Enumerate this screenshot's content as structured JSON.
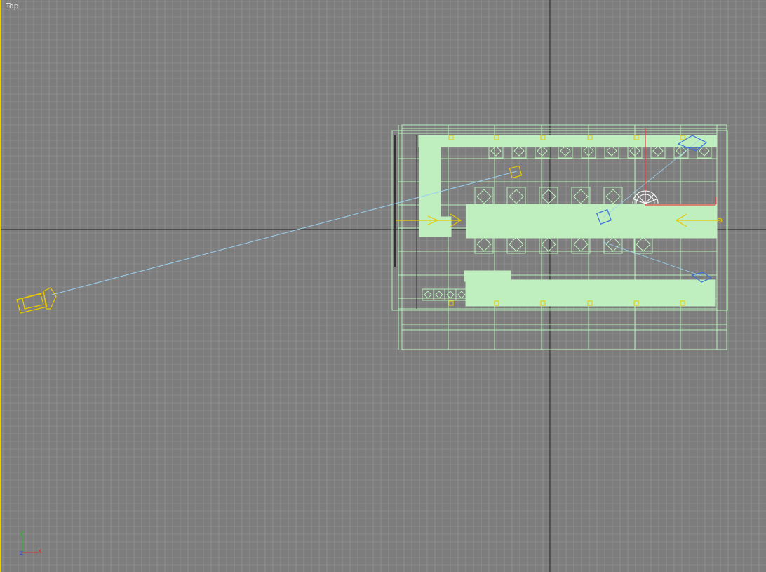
{
  "viewport": {
    "label": "Top",
    "active_border_color": "#e8d000",
    "background_color": "#7d7d7d",
    "grid_color": "#9a9a9a",
    "home_axis_color": "#1a1a1a"
  },
  "scene": {
    "wireframe_color": "#b8f0b8",
    "solid_fill_color": "#bfeebf",
    "camera_color": "#e8c800",
    "target_line_color": "#9ad0f0",
    "light_color": "#3a6ed8",
    "selection_color": "#e04040",
    "icons": [
      "camera-icon",
      "camera-target-icon",
      "direct-light-icon",
      "omni-light-icon",
      "spotlight-icon"
    ]
  },
  "axis_tripod": {
    "x": "x",
    "y": "y",
    "z": "z",
    "x_color": "#d83030",
    "y_color": "#30b030",
    "z_color": "#3050d0"
  }
}
